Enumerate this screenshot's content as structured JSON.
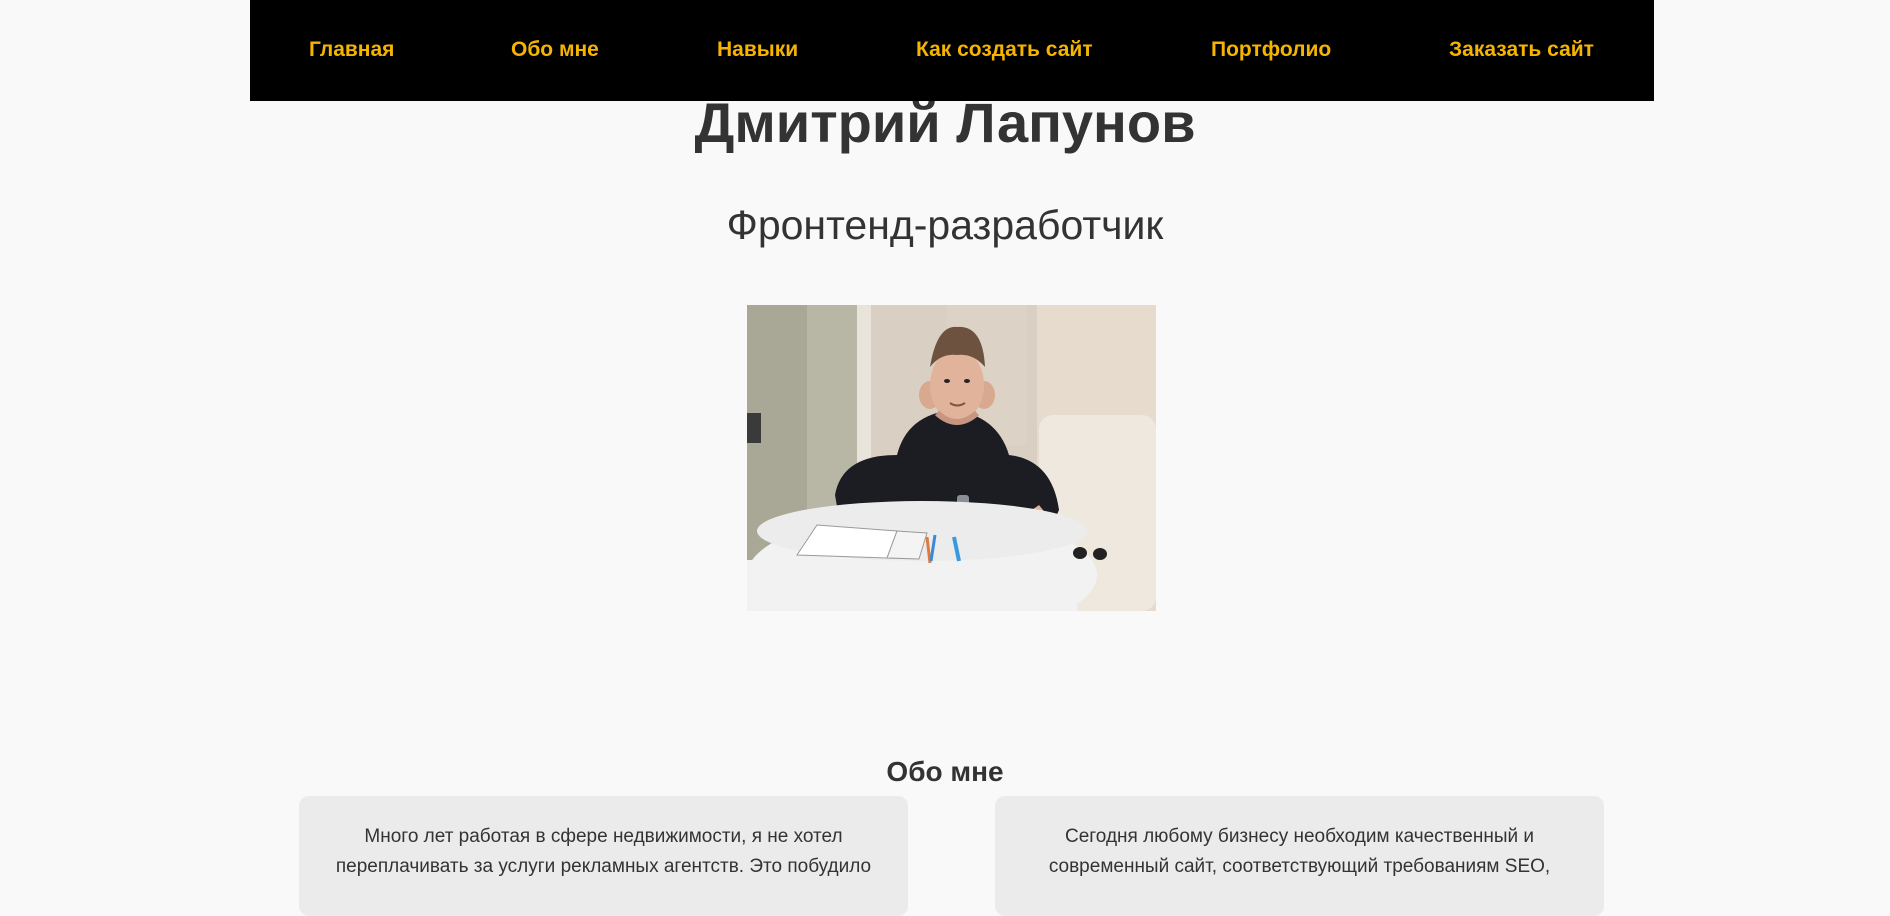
{
  "nav": {
    "items": [
      {
        "label": "Главная"
      },
      {
        "label": "Обо мне"
      },
      {
        "label": "Навыки"
      },
      {
        "label": "Как создать сайт"
      },
      {
        "label": "Портфолио"
      },
      {
        "label": "Заказать сайт"
      }
    ]
  },
  "hero": {
    "name": "Дмитрий Лапунов",
    "role": "Фронтенд-разработчик"
  },
  "about": {
    "title": "Обо мне",
    "cards": [
      {
        "text": "Много лет работая в сфере недвижимости, я не хотел переплачивать за услуги рекламных агентств. Это побудило"
      },
      {
        "text": "Сегодня любому бизнесу необходим качественный и современный сайт, соответствующий требованиям SEO,"
      }
    ]
  },
  "colors": {
    "nav_bg": "#000000",
    "nav_text": "#f5b400",
    "page_bg": "#f9f9f9",
    "card_bg": "#ebebeb",
    "text": "#333333"
  }
}
